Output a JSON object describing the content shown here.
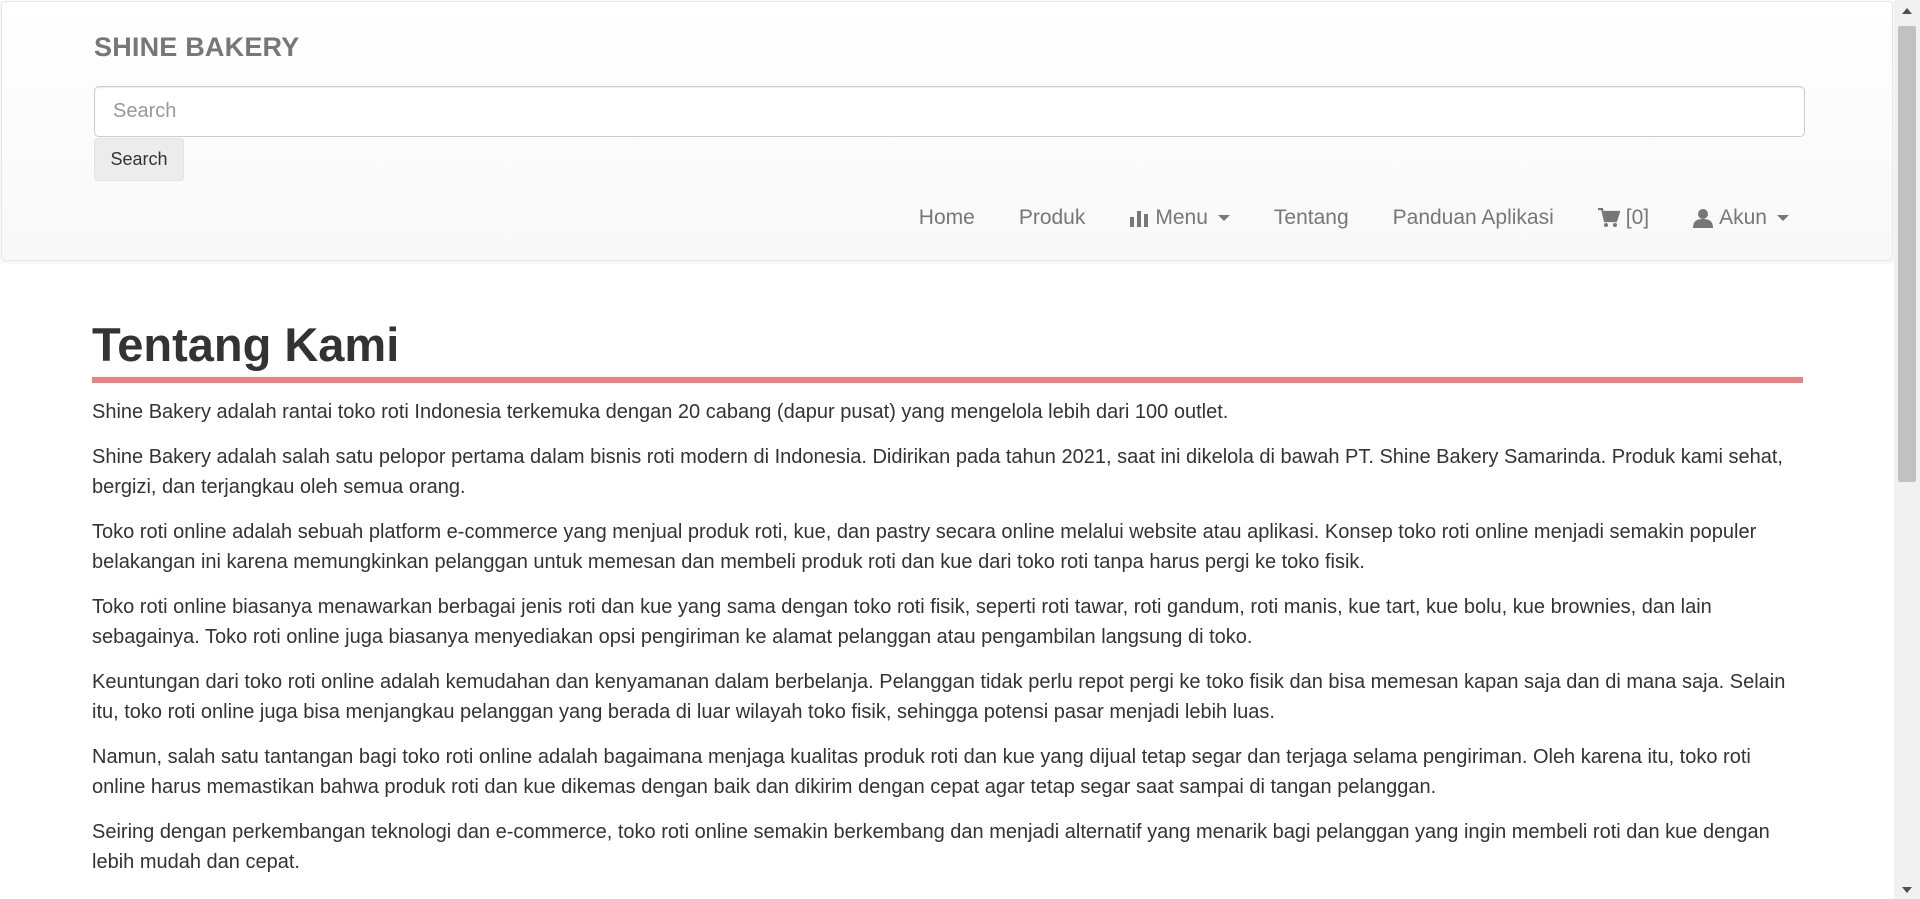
{
  "brand": {
    "name": "SHINE BAKERY"
  },
  "search": {
    "placeholder": "Search",
    "button_label": "Search"
  },
  "nav": {
    "home": "Home",
    "produk": "Produk",
    "menu": "Menu",
    "tentang": "Tentang",
    "panduan": "Panduan Aplikasi",
    "cart": "[0]",
    "akun": "Akun",
    "icons": {
      "menu": "bar-chart-icon",
      "cart": "shopping-cart-icon",
      "akun": "user-icon"
    }
  },
  "page": {
    "title": "Tentang Kami",
    "accent_color": "#f08080",
    "paragraphs": [
      "Shine Bakery adalah rantai toko roti Indonesia terkemuka dengan 20 cabang (dapur pusat) yang mengelola lebih dari 100 outlet.",
      "Shine Bakery adalah salah satu pelopor pertama dalam bisnis roti modern di Indonesia. Didirikan pada tahun 2021, saat ini dikelola di bawah PT. Shine Bakery Samarinda. Produk kami sehat, bergizi, dan terjangkau oleh semua orang.",
      "Toko roti online adalah sebuah platform e-commerce yang menjual produk roti, kue, dan pastry secara online melalui website atau aplikasi. Konsep toko roti online menjadi semakin populer belakangan ini karena memungkinkan pelanggan untuk memesan dan membeli produk roti dan kue dari toko roti tanpa harus pergi ke toko fisik.",
      "Toko roti online biasanya menawarkan berbagai jenis roti dan kue yang sama dengan toko roti fisik, seperti roti tawar, roti gandum, roti manis, kue tart, kue bolu, kue brownies, dan lain sebagainya. Toko roti online juga biasanya menyediakan opsi pengiriman ke alamat pelanggan atau pengambilan langsung di toko.",
      "Keuntungan dari toko roti online adalah kemudahan dan kenyamanan dalam berbelanja. Pelanggan tidak perlu repot pergi ke toko fisik dan bisa memesan kapan saja dan di mana saja. Selain itu, toko roti online juga bisa menjangkau pelanggan yang berada di luar wilayah toko fisik, sehingga potensi pasar menjadi lebih luas.",
      "Namun, salah satu tantangan bagi toko roti online adalah bagaimana menjaga kualitas produk roti dan kue yang dijual tetap segar dan terjaga selama pengiriman. Oleh karena itu, toko roti online harus memastikan bahwa produk roti dan kue dikemas dengan baik dan dikirim dengan cepat agar tetap segar saat sampai di tangan pelanggan.",
      "Seiring dengan perkembangan teknologi dan e-commerce, toko roti online semakin berkembang dan menjadi alternatif yang menarik bagi pelanggan yang ingin membeli roti dan kue dengan lebih mudah dan cepat."
    ]
  }
}
